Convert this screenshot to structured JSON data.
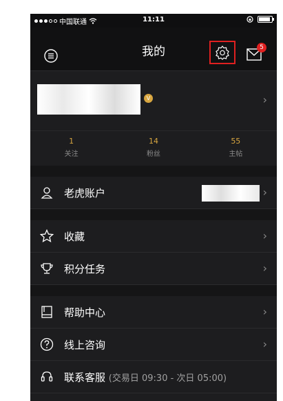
{
  "status_bar": {
    "carrier": "中国联通",
    "time": "11:11",
    "signal_dots": [
      "full",
      "full",
      "full",
      "empty",
      "empty"
    ]
  },
  "nav": {
    "title": "我的",
    "mail_badge": "5",
    "highlight_color": "#e02020"
  },
  "profile": {
    "vip_badge": "V"
  },
  "stats": [
    {
      "value": "1",
      "label": "关注"
    },
    {
      "value": "14",
      "label": "粉丝"
    },
    {
      "value": "55",
      "label": "主帖"
    }
  ],
  "menu": {
    "tiger_account": "老虎账户",
    "favorites": "收藏",
    "points_tasks": "积分任务",
    "help_center": "帮助中心",
    "online_consult": "线上咨询",
    "contact_service": "联系客服",
    "contact_service_hours": "(交易日 09:30 - 次日 05:00)"
  },
  "colors": {
    "accent_gold": "#d8a640",
    "background": "#1d1d1f"
  }
}
